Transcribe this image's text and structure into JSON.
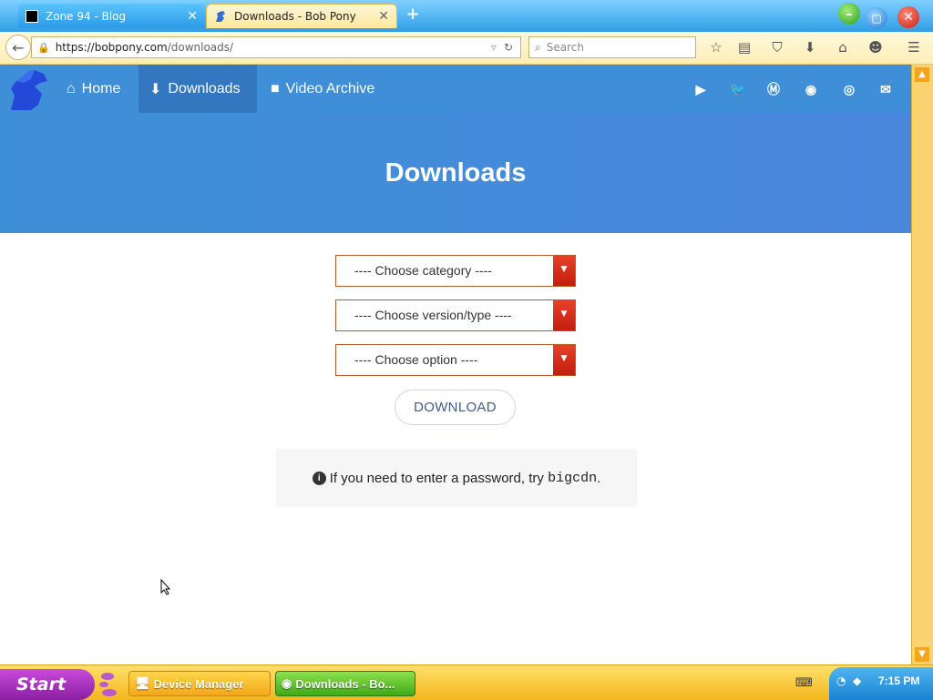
{
  "browser": {
    "tabs": [
      {
        "title": "Zone 94 - Blog",
        "close": "✕",
        "active": false
      },
      {
        "title": "Downloads - Bob Pony",
        "close": "✕",
        "active": true
      }
    ],
    "new_tab": "+",
    "url_host": "https://bobpony.com",
    "url_path": "/downloads/",
    "search_placeholder": "Search",
    "toolbar_icons": [
      "star-icon",
      "reader-icon",
      "pocket-icon",
      "download-icon",
      "home-icon",
      "smiley-icon",
      "menu-icon"
    ]
  },
  "site": {
    "nav": [
      {
        "label": "Home",
        "icon": "home-icon"
      },
      {
        "label": "Downloads",
        "icon": "download-icon"
      },
      {
        "label": "Video Archive",
        "icon": "video-camera-icon"
      }
    ],
    "social_icons": [
      "youtube-icon",
      "twitter-icon",
      "mastodon-icon",
      "discord-icon",
      "github-icon",
      "email-icon"
    ],
    "hero_title": "Downloads",
    "selects": [
      {
        "placeholder": "---- Choose category ----"
      },
      {
        "placeholder": "---- Choose version/type ----"
      },
      {
        "placeholder": "---- Choose option ----"
      }
    ],
    "download_button": "DOWNLOAD",
    "notice_text": "If you need to enter a password, try",
    "notice_code": "bigcdn",
    "notice_end": "."
  },
  "taskbar": {
    "start": "Start",
    "tasks": [
      {
        "label": "Device Manager"
      },
      {
        "label": "Downloads - Bo..."
      }
    ],
    "clock": "7:15 PM"
  },
  "colors": {
    "site_nav": "#3f8fd8",
    "hero": "#4a88de",
    "select_caret": "#d9301c",
    "tab_strip": "#2f9fe6",
    "taskbar": "#f2b71c"
  }
}
